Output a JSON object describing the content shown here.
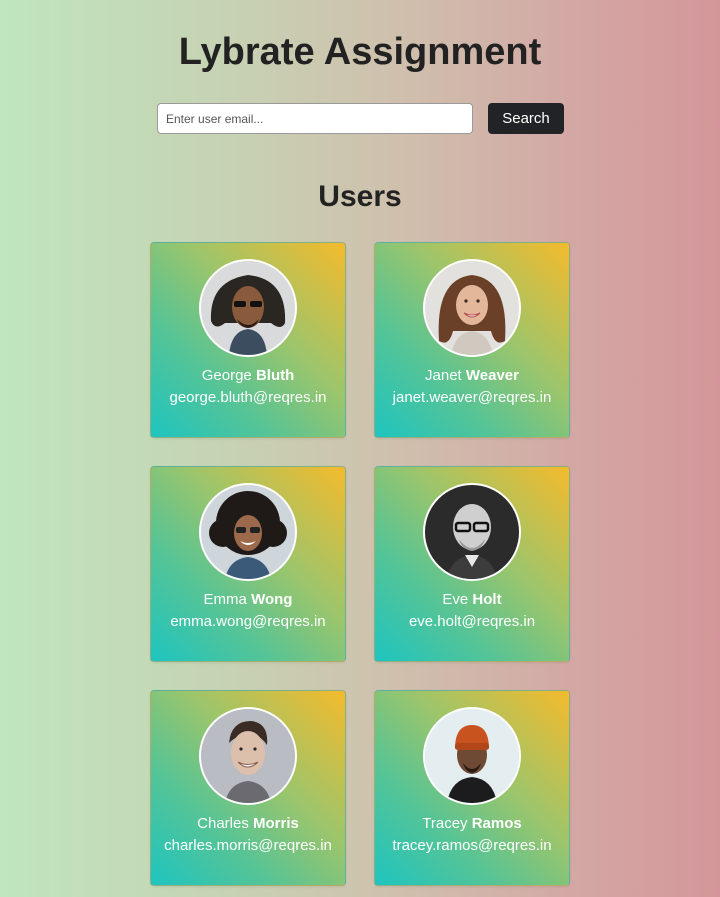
{
  "app": {
    "title": "Lybrate Assignment"
  },
  "search": {
    "placeholder": "Enter user email...",
    "value": "",
    "button_label": "Search"
  },
  "users_section": {
    "title": "Users"
  },
  "users": [
    {
      "first_name": "George",
      "last_name": "Bluth",
      "email": "george.bluth@reqres.in"
    },
    {
      "first_name": "Janet",
      "last_name": "Weaver",
      "email": "janet.weaver@reqres.in"
    },
    {
      "first_name": "Emma",
      "last_name": "Wong",
      "email": "emma.wong@reqres.in"
    },
    {
      "first_name": "Eve",
      "last_name": "Holt",
      "email": "eve.holt@reqres.in"
    },
    {
      "first_name": "Charles",
      "last_name": "Morris",
      "email": "charles.morris@reqres.in"
    },
    {
      "first_name": "Tracey",
      "last_name": "Ramos",
      "email": "tracey.ramos@reqres.in"
    }
  ],
  "colors": {
    "card_gradient_top": "#f5ba2c",
    "card_gradient_bottom": "#1ec4c0",
    "button_bg": "#222326"
  }
}
